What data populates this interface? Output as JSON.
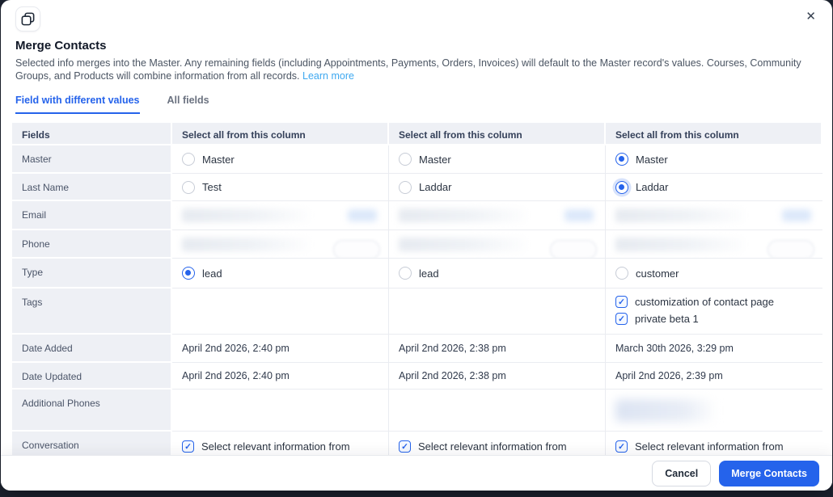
{
  "modal": {
    "title": "Merge Contacts",
    "description": "Selected info merges into the Master. Any remaining fields (including Appointments, Payments, Orders, Invoices) will default to the Master record's values. Courses, Community Groups, and Products will combine information from all records.",
    "learn_more_label": "Learn more"
  },
  "icons": {
    "header_icon": "merge-overlapping-squares-icon",
    "close_glyph": "✕",
    "checkbox_check_glyph": "✓"
  },
  "tabs": [
    {
      "label": "Field with different values",
      "active": true
    },
    {
      "label": "All fields",
      "active": false
    }
  ],
  "table": {
    "fields_label": "Fields",
    "select_all_labels": [
      "Select all from this column",
      "Select all from this column",
      "Select all from this column"
    ],
    "rows": [
      {
        "field": "Master",
        "cells": [
          {
            "kind": "radio",
            "label": "Master",
            "checked": false
          },
          {
            "kind": "radio",
            "label": "Master",
            "checked": false
          },
          {
            "kind": "radio",
            "label": "Master",
            "checked": true
          }
        ]
      },
      {
        "field": "Last Name",
        "cells": [
          {
            "kind": "radio",
            "label": "Test",
            "checked": false
          },
          {
            "kind": "radio",
            "label": "Laddar",
            "checked": false
          },
          {
            "kind": "radio",
            "label": "Laddar",
            "checked": true,
            "focused": true
          }
        ]
      },
      {
        "field": "Email",
        "cells": [
          {
            "kind": "redacted",
            "parts": [
              "bar",
              "chip"
            ]
          },
          {
            "kind": "redacted",
            "parts": [
              "bar",
              "chip"
            ]
          },
          {
            "kind": "redacted",
            "parts": [
              "bar",
              "chip"
            ]
          }
        ]
      },
      {
        "field": "Phone",
        "cells": [
          {
            "kind": "redacted",
            "parts": [
              "bar",
              "pill"
            ]
          },
          {
            "kind": "redacted",
            "parts": [
              "bar",
              "pill"
            ]
          },
          {
            "kind": "redacted",
            "parts": [
              "bar",
              "pill"
            ]
          }
        ]
      },
      {
        "field": "Type",
        "cells": [
          {
            "kind": "radio",
            "label": "lead",
            "checked": true
          },
          {
            "kind": "radio",
            "label": "lead",
            "checked": false
          },
          {
            "kind": "radio",
            "label": "customer",
            "checked": false
          }
        ]
      },
      {
        "field": "Tags",
        "cells": [
          {
            "kind": "empty"
          },
          {
            "kind": "empty"
          },
          {
            "kind": "checkbox_list",
            "items": [
              {
                "label": "customization of contact page",
                "checked": true
              },
              {
                "label": "private beta 1",
                "checked": true
              }
            ]
          }
        ]
      },
      {
        "field": "Date Added",
        "cells": [
          {
            "kind": "text",
            "value": "April 2nd 2026, 2:40 pm"
          },
          {
            "kind": "text",
            "value": "April 2nd 2026, 2:38 pm"
          },
          {
            "kind": "text",
            "value": "March 30th 2026, 3:29 pm"
          }
        ]
      },
      {
        "field": "Date Updated",
        "cells": [
          {
            "kind": "text",
            "value": "April 2nd 2026, 2:40 pm"
          },
          {
            "kind": "text",
            "value": "April 2nd 2026, 2:38 pm"
          },
          {
            "kind": "text",
            "value": "April 2nd 2026, 2:39 pm"
          }
        ]
      },
      {
        "field": "Additional Phones",
        "cells": [
          {
            "kind": "empty"
          },
          {
            "kind": "empty"
          },
          {
            "kind": "redacted",
            "parts": [
              "bar-blue"
            ]
          }
        ]
      },
      {
        "field": "Conversation",
        "cells": [
          {
            "kind": "checkbox",
            "label": "Select relevant information from",
            "checked": true
          },
          {
            "kind": "checkbox",
            "label": "Select relevant information from",
            "checked": true
          },
          {
            "kind": "checkbox",
            "label": "Select relevant information from",
            "checked": true
          }
        ]
      }
    ]
  },
  "footer": {
    "cancel_label": "Cancel",
    "merge_label": "Merge Contacts"
  },
  "colors": {
    "accent_blue": "#2563eb",
    "link_blue": "#3ea8f0",
    "table_header_bg": "#eef0f5",
    "backdrop": "#1d2330",
    "merge_button_bg": "#2563eb"
  }
}
